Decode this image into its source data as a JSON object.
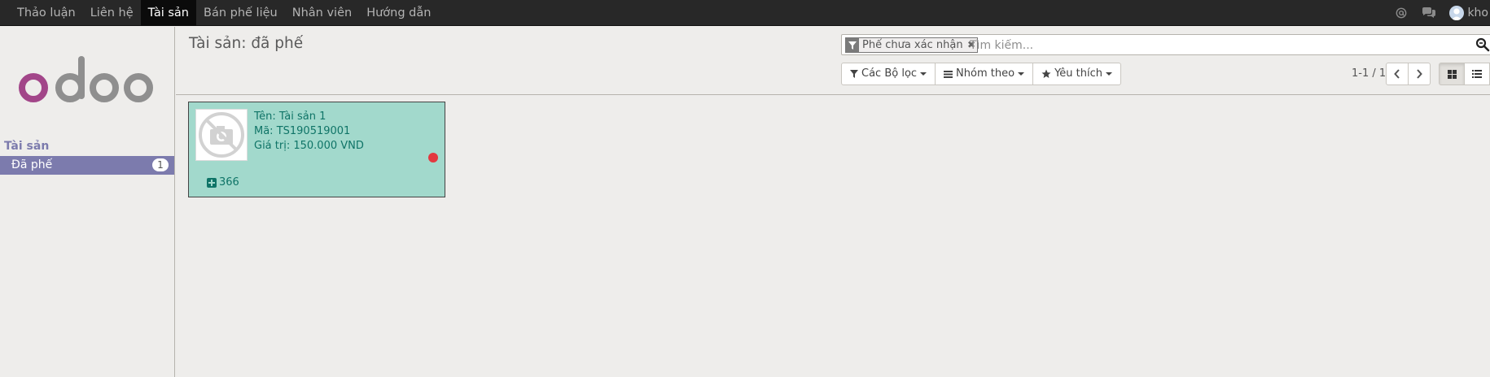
{
  "topnav": {
    "menu": [
      "Thảo luận",
      "Liên hệ",
      "Tài sản",
      "Bán phế liệu",
      "Nhân viên",
      "Hướng dẫn"
    ],
    "active_index": 2,
    "icons": [
      "at-icon",
      "chat-icon"
    ],
    "user_name": "kho"
  },
  "sidebar": {
    "logo_text": "odoo",
    "section_title": "Tài sản",
    "items": [
      {
        "label": "Đã phế",
        "count": "1",
        "active": true
      }
    ]
  },
  "control_panel": {
    "breadcrumb": "Tài sản: đã phế",
    "search": {
      "facet_label": "Phế chưa xác nhận",
      "placeholder": "Tìm kiếm..."
    },
    "buttons": {
      "filters": "Các Bộ lọc",
      "group_by": "Nhóm theo",
      "favorites": "Yêu thích"
    },
    "pager": "1-1 / 1",
    "views": [
      "kanban",
      "list"
    ],
    "active_view": "kanban"
  },
  "kanban": {
    "records": [
      {
        "name_line": "Tên: Tài sản 1",
        "code_line": "Mã: TS190519001",
        "value_line": "Giá trị: 150.000 VND",
        "count": "366",
        "state_color": "#e3383f"
      }
    ]
  },
  "colors": {
    "navbar": "#282828",
    "brand": "#7c7bad",
    "card_bg": "#a2d9cc",
    "card_text": "#0f7467"
  }
}
